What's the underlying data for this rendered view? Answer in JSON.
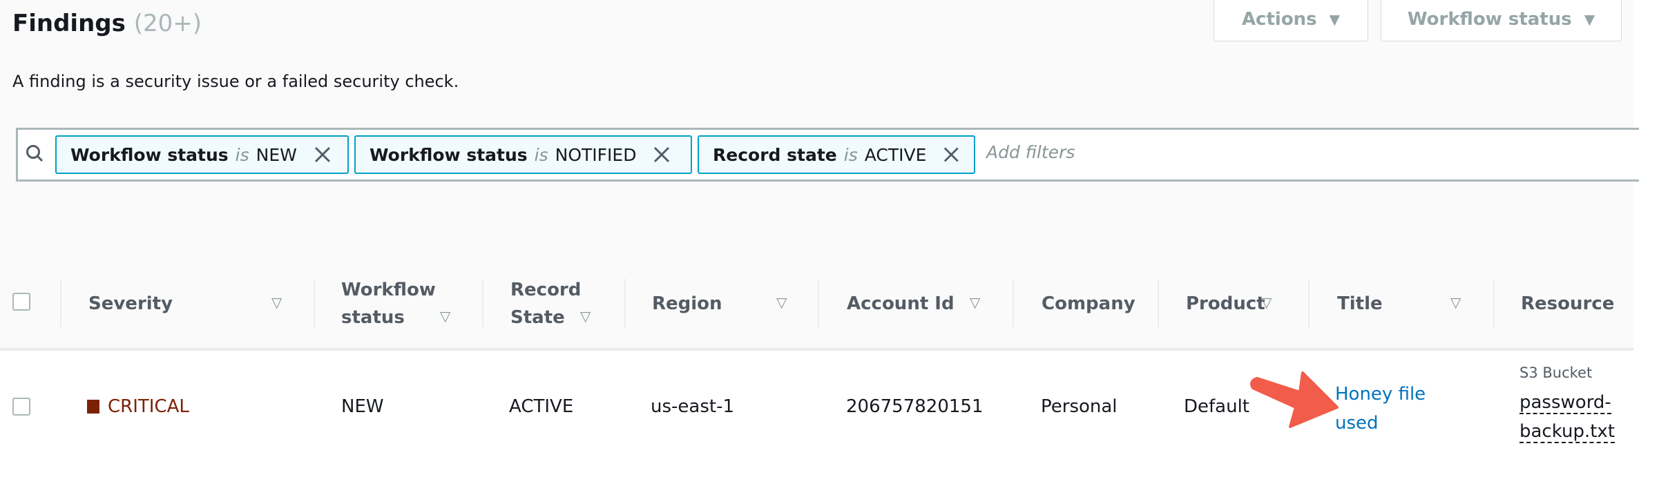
{
  "header": {
    "title": "Findings",
    "count": "(20+)",
    "description": "A finding is a security issue or a failed security check."
  },
  "buttons": {
    "actions": "Actions",
    "workflow_status": "Workflow status"
  },
  "filters": {
    "tokens": [
      {
        "key": "Workflow status",
        "op": "is",
        "value": "NEW"
      },
      {
        "key": "Workflow status",
        "op": "is",
        "value": "NOTIFIED"
      },
      {
        "key": "Record state",
        "op": "is",
        "value": "ACTIVE"
      }
    ],
    "placeholder": "Add filters"
  },
  "table": {
    "columns": {
      "severity": "Severity",
      "workflow_1": "Workflow",
      "workflow_2": "status",
      "record_1": "Record",
      "record_2": "State",
      "region": "Region",
      "account": "Account Id",
      "company": "Company",
      "product": "Product",
      "title": "Title",
      "resource": "Resource"
    },
    "rows": [
      {
        "severity": "CRITICAL",
        "workflow": "NEW",
        "record": "ACTIVE",
        "region": "us-east-1",
        "account": "206757820151",
        "company": "Personal",
        "product": "Default",
        "title_1": "Honey file",
        "title_2": "used",
        "resource_type": "S3 Bucket",
        "resource_1": "password-",
        "resource_2": "backup.txt"
      }
    ]
  },
  "colors": {
    "critical": "#7d2105",
    "link": "#0073bb",
    "token_border": "#00a1c9",
    "annotation_arrow": "#f25c4a"
  },
  "icons": {
    "search": "search-icon",
    "remove": "close-icon",
    "sort": "sort-caret-icon",
    "dropdown": "caret-down-icon"
  }
}
